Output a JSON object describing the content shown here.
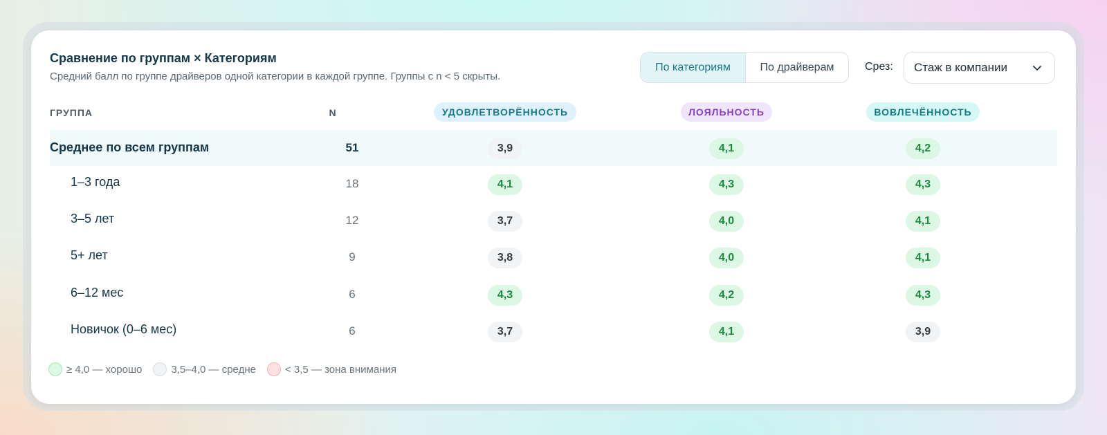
{
  "header": {
    "title": "Сравнение по группам × Категориям",
    "subtitle": "Средний балл по группе драйверов одной категории в каждой группе. Группы с n < 5 скрыты."
  },
  "view_toggle": {
    "options": [
      "По категориям",
      "По драйверам"
    ],
    "selected": "По категориям"
  },
  "slice": {
    "label": "Срез:",
    "value": "Стаж в компании"
  },
  "table": {
    "col_group": "ГРУППА",
    "col_n": "N",
    "categories": [
      {
        "label": "УДОВЛЕТВОРЁННОСТЬ",
        "color": "#177a8c",
        "bg": "#dff2fb"
      },
      {
        "label": "ЛОЯЛЬНОСТЬ",
        "color": "#8a3fc4",
        "bg": "#efe6fb"
      },
      {
        "label": "ВОВЛЕЧЁННОСТЬ",
        "color": "#0f7d82",
        "bg": "#d5f7f6"
      }
    ],
    "rows": [
      {
        "name": "Среднее по всем группам",
        "n": "51",
        "highlight": true,
        "scores": [
          {
            "v": "3,9",
            "level": "mid"
          },
          {
            "v": "4,1",
            "level": "good"
          },
          {
            "v": "4,2",
            "level": "good"
          }
        ]
      },
      {
        "name": "1–3 года",
        "n": "18",
        "highlight": false,
        "scores": [
          {
            "v": "4,1",
            "level": "good"
          },
          {
            "v": "4,3",
            "level": "good"
          },
          {
            "v": "4,3",
            "level": "good"
          }
        ]
      },
      {
        "name": "3–5 лет",
        "n": "12",
        "highlight": false,
        "scores": [
          {
            "v": "3,7",
            "level": "mid"
          },
          {
            "v": "4,0",
            "level": "good"
          },
          {
            "v": "4,1",
            "level": "good"
          }
        ]
      },
      {
        "name": "5+ лет",
        "n": "9",
        "highlight": false,
        "scores": [
          {
            "v": "3,8",
            "level": "mid"
          },
          {
            "v": "4,0",
            "level": "good"
          },
          {
            "v": "4,1",
            "level": "good"
          }
        ]
      },
      {
        "name": "6–12 мес",
        "n": "6",
        "highlight": false,
        "scores": [
          {
            "v": "4,3",
            "level": "good"
          },
          {
            "v": "4,2",
            "level": "good"
          },
          {
            "v": "4,3",
            "level": "good"
          }
        ]
      },
      {
        "name": "Новичок (0–6 мес)",
        "n": "6",
        "highlight": false,
        "scores": [
          {
            "v": "3,7",
            "level": "mid"
          },
          {
            "v": "4,1",
            "level": "good"
          },
          {
            "v": "3,9",
            "level": "mid"
          }
        ]
      }
    ]
  },
  "legend": [
    {
      "label": "≥ 4,0 — хорошо",
      "level": "good"
    },
    {
      "label": "3,5–4,0 — средне",
      "level": "mid"
    },
    {
      "label": "< 3,5 — зона внимания",
      "level": "warn"
    }
  ]
}
